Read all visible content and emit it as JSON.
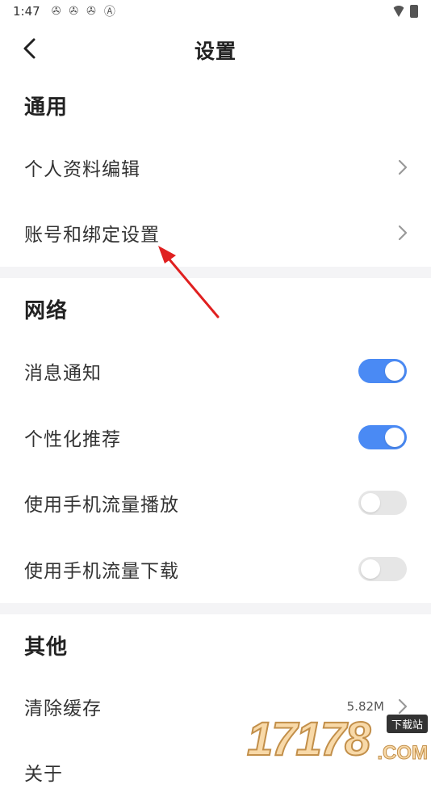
{
  "status_bar": {
    "time": "1:47",
    "icons": [
      "app-icon",
      "app-icon",
      "app-icon",
      "a-icon"
    ],
    "right_icons": [
      "wifi-icon",
      "battery-icon"
    ]
  },
  "header": {
    "title": "设置",
    "back_icon": "chevron-left-icon"
  },
  "sections": {
    "general": {
      "title": "通用",
      "items": [
        {
          "label": "个人资料编辑"
        },
        {
          "label": "账号和绑定设置"
        }
      ]
    },
    "network": {
      "title": "网络",
      "items": [
        {
          "label": "消息通知",
          "on": true
        },
        {
          "label": "个性化推荐",
          "on": true
        },
        {
          "label": "使用手机流量播放",
          "on": false
        },
        {
          "label": "使用手机流量下载",
          "on": false
        }
      ]
    },
    "other": {
      "title": "其他",
      "items": [
        {
          "label": "清除缓存",
          "value": "5.82M"
        },
        {
          "label": "关于"
        }
      ]
    }
  },
  "colors": {
    "toggle_on": "#4a8af4",
    "toggle_off": "#e6e6e6",
    "annotation_arrow": "#e02020"
  },
  "watermark": {
    "number": "17178",
    "badge": "下载站",
    "suffix": ".COM"
  }
}
